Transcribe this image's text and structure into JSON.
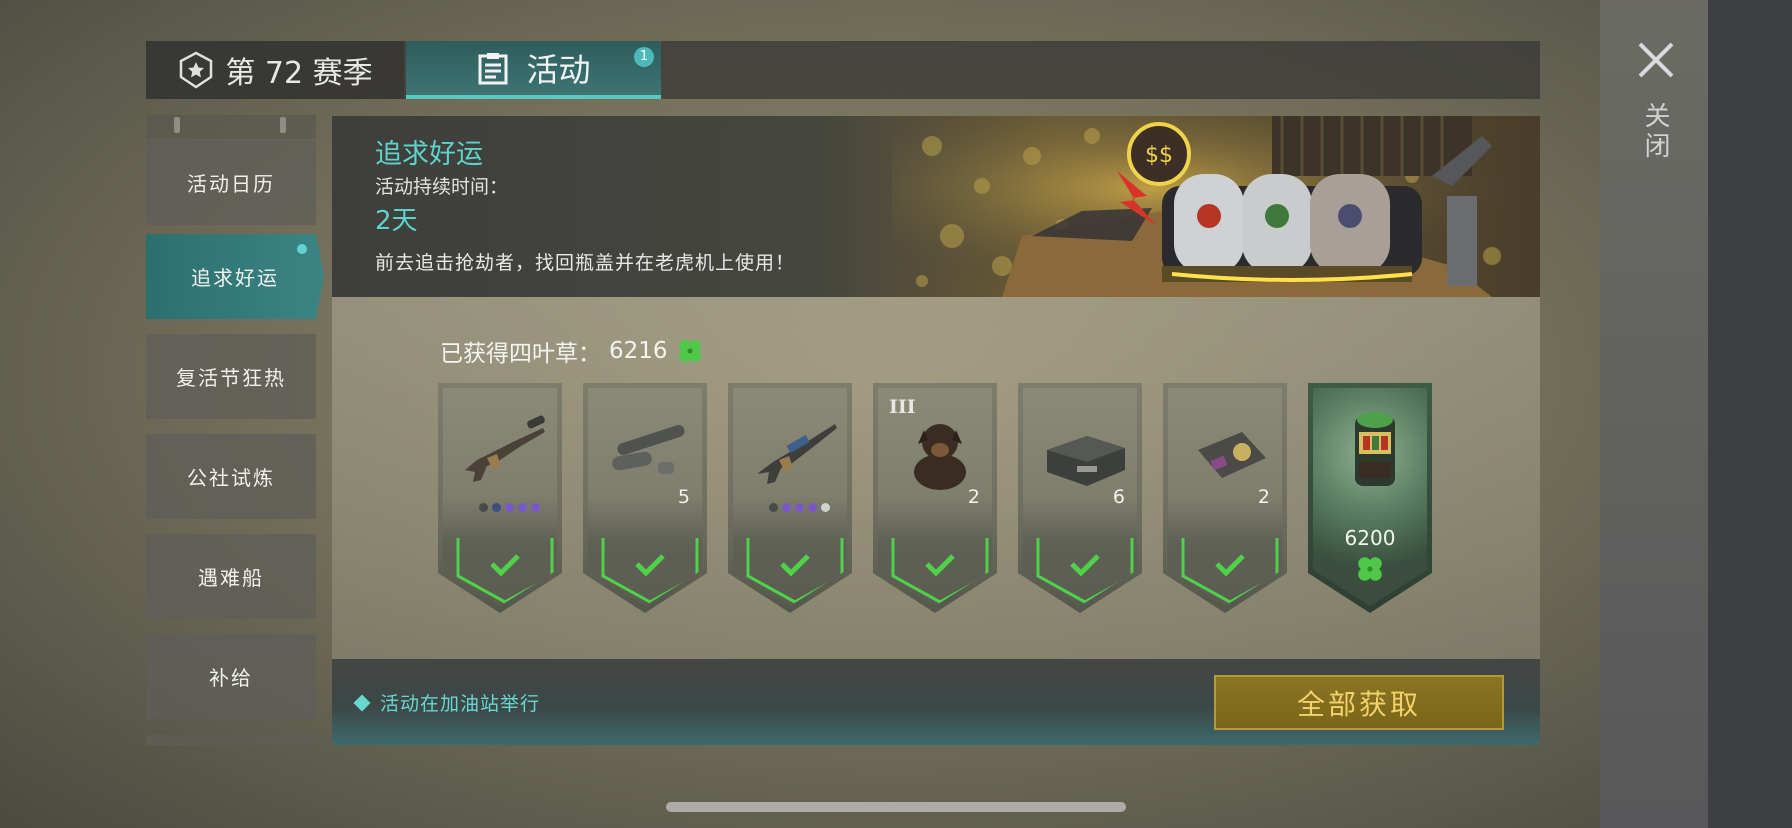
{
  "top_tabs": {
    "season_label": "第 72 赛季",
    "event_label": "活动",
    "event_badge": "1"
  },
  "close": {
    "label": "关闭"
  },
  "sidebar": {
    "items": [
      {
        "label": "活动日历"
      },
      {
        "label": "追求好运"
      },
      {
        "label": "复活节狂热"
      },
      {
        "label": "公社试炼"
      },
      {
        "label": "遇难船"
      },
      {
        "label": "补给"
      }
    ]
  },
  "event": {
    "title": "追求好运",
    "duration_label": "活动持续时间：",
    "duration": "2天",
    "description": "前去追击抢劫者，找回瓶盖并在老虎机上使用！"
  },
  "progress": {
    "label": "已获得四叶草：",
    "value": "6216",
    "icon": "four-leaf-clover-icon"
  },
  "rewards": [
    {
      "item": "rifle-icon",
      "count": "",
      "claimed": true,
      "rarity_dots": [
        "#4a4a4a",
        "#3b4f80",
        "#7a57c8",
        "#7a57c8",
        "#7a57c8"
      ]
    },
    {
      "item": "launcher-parts-icon",
      "count": "5",
      "claimed": true
    },
    {
      "item": "assault-rifle-icon",
      "count": "",
      "claimed": true,
      "rarity_dots": [
        "#4a4a4a",
        "#7a57c8",
        "#7a57c8",
        "#7a57c8",
        "#d0d0d0"
      ]
    },
    {
      "item": "dog-icon",
      "count": "2",
      "tier": "III",
      "claimed": true
    },
    {
      "item": "weapon-crate-icon",
      "count": "6",
      "claimed": true
    },
    {
      "item": "badge-wallet-icon",
      "count": "2",
      "claimed": true
    },
    {
      "item": "slot-machine-icon",
      "cost": "6200",
      "claimed": false
    }
  ],
  "footer": {
    "note": "活动在加油站举行",
    "claim_all": "全部获取"
  },
  "colors": {
    "accent": "#5fd2cc",
    "check": "#4fd14a",
    "claim_button": "#8a7523"
  }
}
